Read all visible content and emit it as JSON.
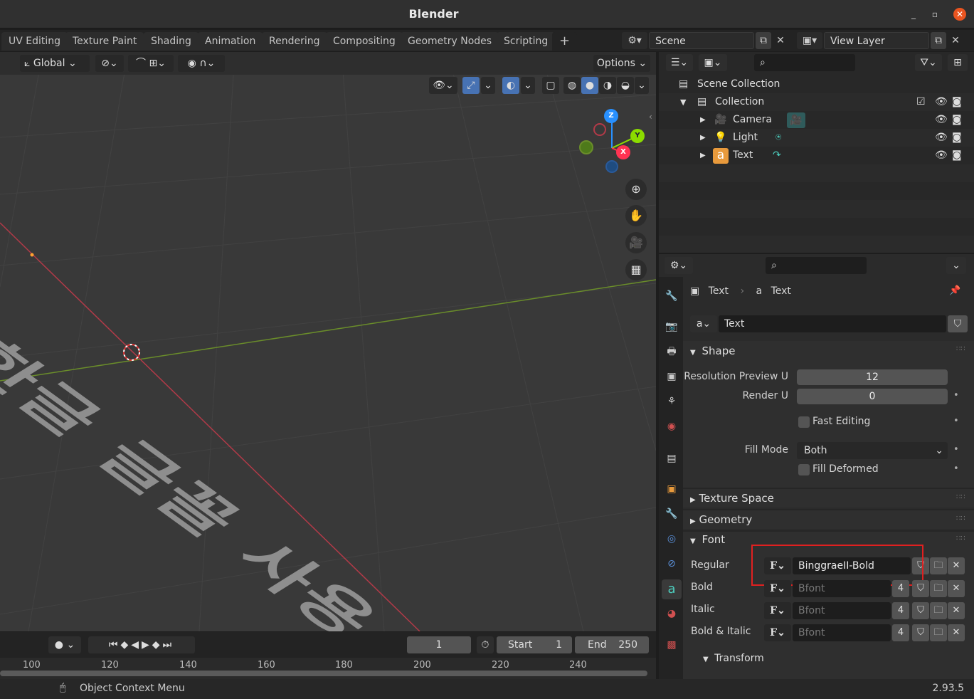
{
  "app": {
    "title": "Blender",
    "version": "2.93.5"
  },
  "window": {
    "minimize": "_",
    "maximize": "▫",
    "close": "✕"
  },
  "workspaces": [
    "UV Editing",
    "Texture Paint",
    "Shading",
    "Animation",
    "Rendering",
    "Compositing",
    "Geometry Nodes",
    "Scripting",
    "+"
  ],
  "scene": {
    "name": "Scene",
    "view_layer": "View Layer"
  },
  "viewport": {
    "orientation": "Global",
    "options_label": "Options",
    "text_object": "한글 글꼴 사용",
    "gizmo": {
      "x": "X",
      "y": "Y",
      "z": "Z"
    }
  },
  "outliner": {
    "root": "Scene Collection",
    "collection": "Collection",
    "items": [
      "Camera",
      "Light",
      "Text"
    ]
  },
  "properties": {
    "breadcrumb_object": "Text",
    "breadcrumb_data": "Text",
    "datablock_name": "Text",
    "shape": {
      "header": "Shape",
      "resolution_preview_label": "Resolution Preview U",
      "resolution_preview_value": "12",
      "render_u_label": "Render U",
      "render_u_value": "0",
      "fast_editing_label": "Fast Editing",
      "fill_mode_label": "Fill Mode",
      "fill_mode_value": "Both",
      "fill_deformed_label": "Fill Deformed"
    },
    "texture_space_header": "Texture Space",
    "geometry_header": "Geometry",
    "font": {
      "header": "Font",
      "regular_label": "Regular",
      "regular_value": "BinggraeII-Bold",
      "bold_label": "Bold",
      "bold_value": "Bfont",
      "bold_users": "4",
      "italic_label": "Italic",
      "italic_value": "Bfont",
      "italic_users": "4",
      "bolditalic_label": "Bold & Italic",
      "bolditalic_value": "Bfont",
      "bolditalic_users": "4",
      "transform_header": "Transform"
    }
  },
  "timeline": {
    "current_frame": "1",
    "start_label": "Start",
    "start_value": "1",
    "end_label": "End",
    "end_value": "250",
    "ruler": [
      "100",
      "120",
      "140",
      "160",
      "180",
      "200",
      "220",
      "240"
    ]
  },
  "status": {
    "context_menu": "Object Context Menu"
  },
  "colors": {
    "highlight": "#e02020",
    "accent": "#4772b3",
    "x_axis": "#ff3352",
    "y_axis": "#8bdc00",
    "z_axis": "#2890ff"
  }
}
